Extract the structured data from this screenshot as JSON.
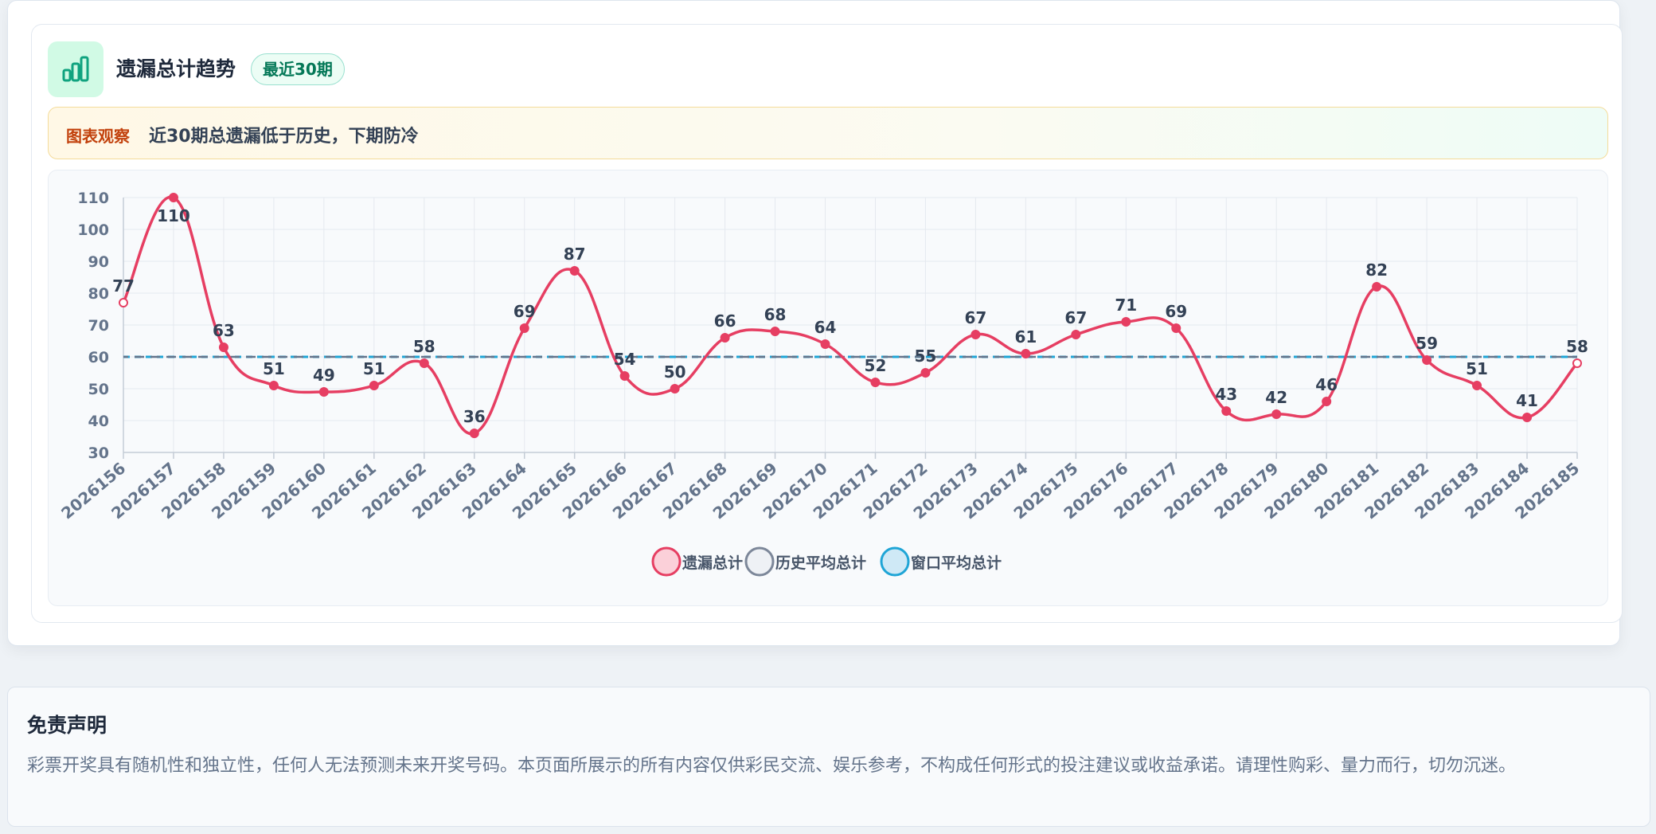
{
  "header": {
    "icon": "bar-chart-icon",
    "title": "遗漏总计趋势",
    "badge": "最近30期"
  },
  "observation": {
    "label": "图表观察",
    "text": "近30期总遗漏低于历史，下期防冷"
  },
  "colors": {
    "primary_line": "#e63e62",
    "history_avg_line": "#64748b",
    "window_avg_line": "#1fa5d6",
    "accent_green": "#10a37f"
  },
  "chart_data": {
    "type": "line",
    "categories": [
      "2026156",
      "2026157",
      "2026158",
      "2026159",
      "2026160",
      "2026161",
      "2026162",
      "2026163",
      "2026164",
      "2026165",
      "2026166",
      "2026167",
      "2026168",
      "2026169",
      "2026170",
      "2026171",
      "2026172",
      "2026173",
      "2026174",
      "2026175",
      "2026176",
      "2026177",
      "2026178",
      "2026179",
      "2026180",
      "2026181",
      "2026182",
      "2026183",
      "2026184",
      "2026185"
    ],
    "series": [
      {
        "name": "遗漏总计",
        "values": [
          77,
          110,
          63,
          51,
          49,
          51,
          58,
          36,
          69,
          87,
          54,
          50,
          66,
          68,
          64,
          52,
          55,
          67,
          61,
          67,
          71,
          69,
          43,
          42,
          46,
          82,
          59,
          51,
          41,
          58
        ],
        "style": "solid-smooth",
        "data_labels": true
      },
      {
        "name": "历史平均总计",
        "values": [
          60,
          60,
          60,
          60,
          60,
          60,
          60,
          60,
          60,
          60,
          60,
          60,
          60,
          60,
          60,
          60,
          60,
          60,
          60,
          60,
          60,
          60,
          60,
          60,
          60,
          60,
          60,
          60,
          60,
          60
        ],
        "style": "dashed"
      },
      {
        "name": "窗口平均总计",
        "values": [
          60,
          60,
          60,
          60,
          60,
          60,
          60,
          60,
          60,
          60,
          60,
          60,
          60,
          60,
          60,
          60,
          60,
          60,
          60,
          60,
          60,
          60,
          60,
          60,
          60,
          60,
          60,
          60,
          60,
          60
        ],
        "style": "dashed"
      }
    ],
    "yticks": [
      30,
      40,
      50,
      60,
      70,
      80,
      90,
      100,
      110
    ],
    "ylim": [
      30,
      110
    ],
    "grid": true,
    "legend_position": "bottom-center"
  },
  "disclaimer": {
    "title": "免责声明",
    "text": "彩票开奖具有随机性和独立性，任何人无法预测未来开奖号码。本页面所展示的所有内容仅供彩民交流、娱乐参考，不构成任何形式的投注建议或收益承诺。请理性购彩、量力而行，切勿沉迷。"
  }
}
